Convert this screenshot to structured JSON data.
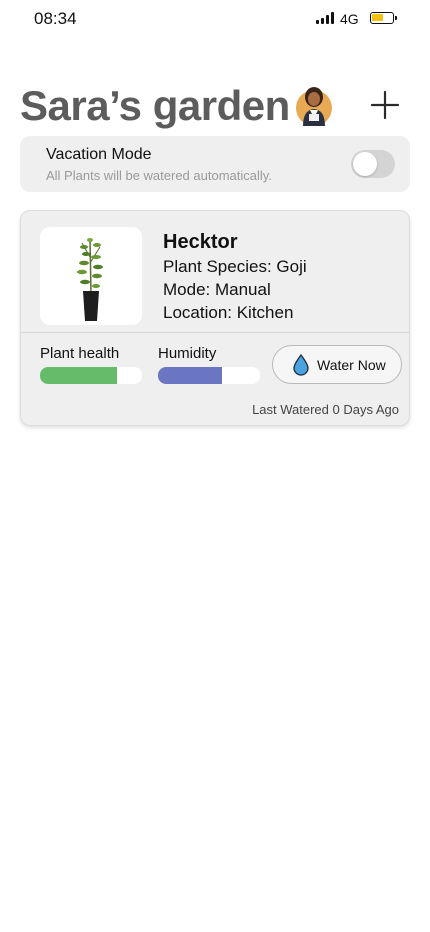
{
  "status_bar": {
    "time": "08:34",
    "network": "4G",
    "battery_level": 0.6
  },
  "header": {
    "title": "Sara’s garden"
  },
  "vacation": {
    "title": "Vacation Mode",
    "subtitle": "All Plants will be watered automatically.",
    "enabled": false
  },
  "plant": {
    "name": "Hecktor",
    "species": "Plant Species: Goji",
    "mode": "Mode: Manual",
    "location": "Location: Kitchen",
    "health_label": "Plant health",
    "health_value": 0.75,
    "humidity_label": "Humidity",
    "humidity_value": 0.63,
    "water_button": "Water Now",
    "last_watered": "Last Watered 0 Days Ago"
  },
  "colors": {
    "health": "#66bb6a",
    "humidity": "#6b76c2",
    "water_drop": "#4aa3df"
  }
}
